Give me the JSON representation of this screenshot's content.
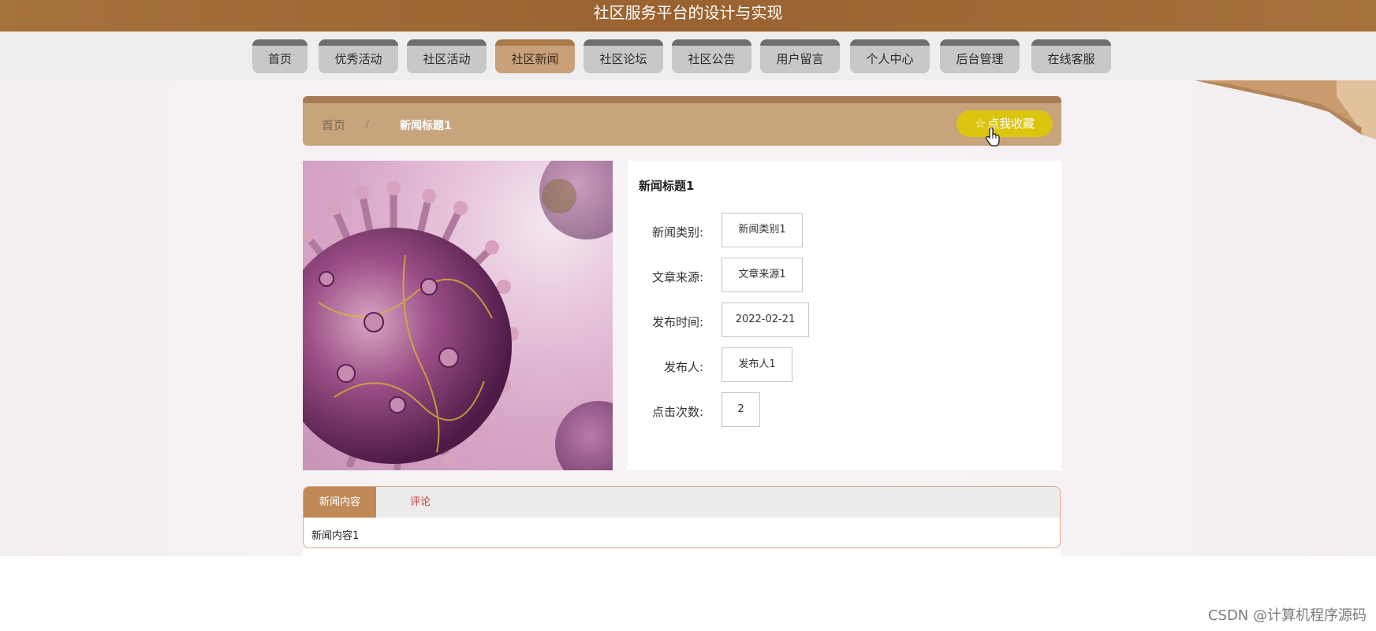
{
  "header": {
    "title": "社区服务平台的设计与实现"
  },
  "nav": {
    "items": [
      {
        "label": "首页"
      },
      {
        "label": "优秀活动"
      },
      {
        "label": "社区活动"
      },
      {
        "label": "社区新闻",
        "active": true
      },
      {
        "label": "社区论坛"
      },
      {
        "label": "社区公告"
      },
      {
        "label": "用户留言"
      },
      {
        "label": "个人中心"
      },
      {
        "label": "后台管理"
      },
      {
        "label": "在线客服"
      }
    ]
  },
  "breadcrumb": {
    "home": "首页",
    "separator": "/",
    "current": "新闻标题1"
  },
  "favorite_button": {
    "label": "点我收藏",
    "icon": "star-outline-icon"
  },
  "news": {
    "title": "新闻标题1",
    "image": "virus-illustration",
    "fields": [
      {
        "label": "新闻类别:",
        "value": "新闻类别1"
      },
      {
        "label": "文章来源:",
        "value": "文章来源1"
      },
      {
        "label": "发布时间:",
        "value": "2022-02-21"
      },
      {
        "label": "发布人:",
        "value": "发布人1"
      },
      {
        "label": "点击次数:",
        "value": "2"
      }
    ]
  },
  "tabs": {
    "items": [
      {
        "label": "新闻内容",
        "active": true
      },
      {
        "label": "评论"
      }
    ],
    "content": "新闻内容1"
  },
  "watermark": "CSDN @计算机程序源码",
  "colors": {
    "header_bg": "#9a6230",
    "accent": "#c8a47c",
    "favorite": "#dcc50f",
    "tab_active": "#c08a58",
    "tab_inactive_text": "#d03a3a"
  }
}
